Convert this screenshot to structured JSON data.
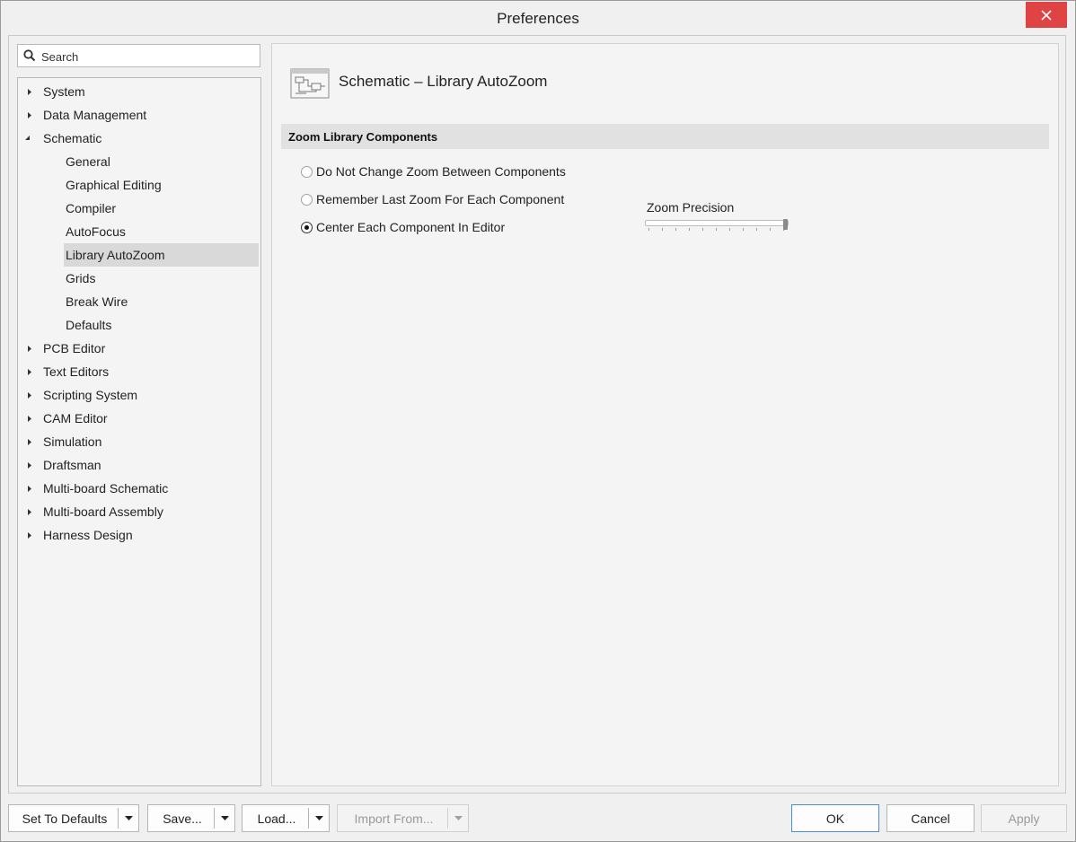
{
  "window": {
    "title": "Preferences"
  },
  "search": {
    "placeholder": "Search"
  },
  "tree": {
    "items": [
      {
        "label": "System",
        "level": 0,
        "expanded": false,
        "selected": false
      },
      {
        "label": "Data Management",
        "level": 0,
        "expanded": false,
        "selected": false
      },
      {
        "label": "Schematic",
        "level": 0,
        "expanded": true,
        "selected": false
      },
      {
        "label": "General",
        "level": 1,
        "selected": false
      },
      {
        "label": "Graphical Editing",
        "level": 1,
        "selected": false
      },
      {
        "label": "Compiler",
        "level": 1,
        "selected": false
      },
      {
        "label": "AutoFocus",
        "level": 1,
        "selected": false
      },
      {
        "label": "Library AutoZoom",
        "level": 1,
        "selected": true
      },
      {
        "label": "Grids",
        "level": 1,
        "selected": false
      },
      {
        "label": "Break Wire",
        "level": 1,
        "selected": false
      },
      {
        "label": "Defaults",
        "level": 1,
        "selected": false
      },
      {
        "label": "PCB Editor",
        "level": 0,
        "expanded": false,
        "selected": false
      },
      {
        "label": "Text Editors",
        "level": 0,
        "expanded": false,
        "selected": false
      },
      {
        "label": "Scripting System",
        "level": 0,
        "expanded": false,
        "selected": false
      },
      {
        "label": "CAM Editor",
        "level": 0,
        "expanded": false,
        "selected": false
      },
      {
        "label": "Simulation",
        "level": 0,
        "expanded": false,
        "selected": false
      },
      {
        "label": "Draftsman",
        "level": 0,
        "expanded": false,
        "selected": false
      },
      {
        "label": "Multi-board Schematic",
        "level": 0,
        "expanded": false,
        "selected": false
      },
      {
        "label": "Multi-board Assembly",
        "level": 0,
        "expanded": false,
        "selected": false
      },
      {
        "label": "Harness Design",
        "level": 0,
        "expanded": false,
        "selected": false
      }
    ]
  },
  "page": {
    "title": "Schematic – Library AutoZoom",
    "icon": "schematic-page-icon",
    "section_title": "Zoom Library Components",
    "options": [
      {
        "label": "Do Not Change Zoom Between Components",
        "checked": false
      },
      {
        "label": "Remember Last Zoom For Each Component",
        "checked": false
      },
      {
        "label": "Center Each Component In Editor",
        "checked": true
      }
    ],
    "zoom_precision": {
      "label": "Zoom Precision",
      "value": 1.0,
      "ticks": 11
    }
  },
  "footer": {
    "set_defaults": "Set To Defaults",
    "save": "Save...",
    "load": "Load...",
    "import_from": "Import From...",
    "ok": "OK",
    "cancel": "Cancel",
    "apply": "Apply"
  },
  "colors": {
    "close_button": "#e04343",
    "selected_row": "#d9d9d9",
    "section_bg": "#e1e1e1"
  }
}
